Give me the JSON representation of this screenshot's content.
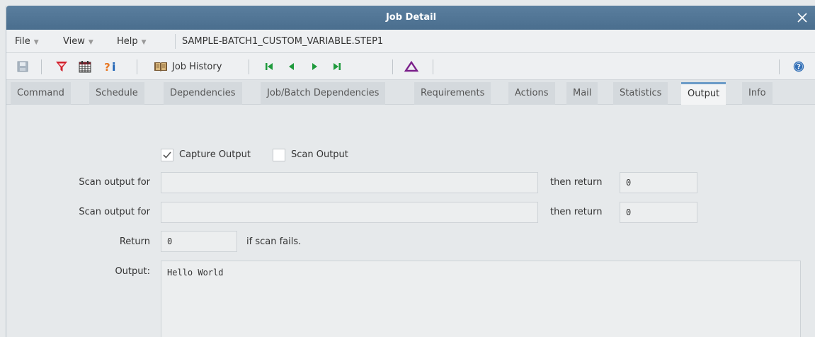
{
  "window": {
    "title": "Job Detail"
  },
  "menu": {
    "file": "File",
    "view": "View",
    "help": "Help",
    "path": "SAMPLE-BATCH1_CUSTOM_VARIABLE.STEP1"
  },
  "toolbar": {
    "job_history_label": "Job History",
    "help_symbol": "?",
    "icons": [
      "save-icon",
      "filter-icon",
      "calendar-icon",
      "info-icon",
      "book-icon",
      "first-icon",
      "previous-icon",
      "next-icon",
      "last-icon",
      "delta-icon",
      "help-icon"
    ]
  },
  "tabs": [
    {
      "label": "Command",
      "active": false
    },
    {
      "label": "Schedule",
      "active": false
    },
    {
      "label": "Dependencies",
      "active": false
    },
    {
      "label": "Job/Batch Dependencies",
      "active": false
    },
    {
      "label": "Requirements",
      "active": false
    },
    {
      "label": "Actions",
      "active": false
    },
    {
      "label": "Mail",
      "active": false
    },
    {
      "label": "Statistics",
      "active": false
    },
    {
      "label": "Output",
      "active": true
    },
    {
      "label": "Info",
      "active": false
    }
  ],
  "output": {
    "capture_label": "Capture Output",
    "capture_checked": true,
    "scan_label": "Scan Output",
    "scan_checked": false,
    "scan_rows": [
      {
        "label": "Scan output for",
        "value": "",
        "then_label": "then return",
        "return_value": "0"
      },
      {
        "label": "Scan output for",
        "value": "",
        "then_label": "then return",
        "return_value": "0"
      }
    ],
    "return_label": "Return",
    "return_value": "0",
    "fail_label": "if scan fails.",
    "output_label": "Output:",
    "output_text": "Hello World"
  },
  "colors": {
    "title_bar": "#4f7393",
    "active_tab_accent": "#6b9bc7",
    "filter_red": "#d21f2b",
    "nav_green": "#1e9a3c",
    "delta_purple": "#7a1f8a",
    "help_blue": "#2f6db5"
  }
}
